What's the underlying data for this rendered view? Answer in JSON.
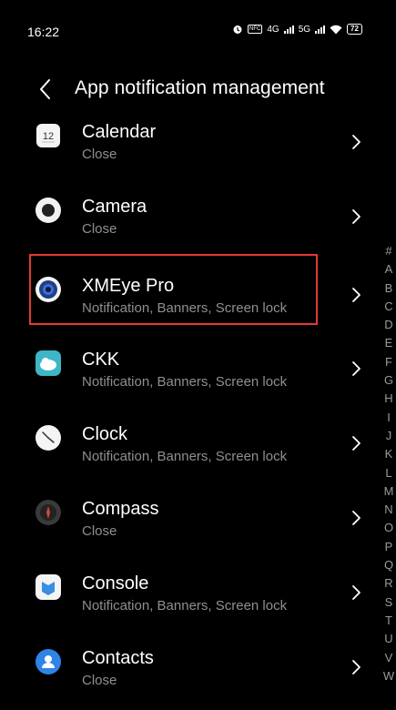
{
  "status_bar": {
    "time": "16:22",
    "nfc_label": "NFC",
    "network_1": "4G",
    "network_2": "5G",
    "battery": "72"
  },
  "header": {
    "back_icon": "chevron-left-icon",
    "title": "App notification management"
  },
  "apps": [
    {
      "name": "Calendar",
      "status": "Close",
      "icon": "calendar-icon",
      "icon_text": "12"
    },
    {
      "name": "Camera",
      "status": "Close",
      "icon": "camera-icon"
    },
    {
      "name": "XMEye Pro",
      "status": "Notification, Banners, Screen lock",
      "icon": "xmeye-icon",
      "highlighted": true,
      "highlight_color": "#e53935"
    },
    {
      "name": "CKK",
      "status": "Notification, Banners, Screen lock",
      "icon": "ckk-icon"
    },
    {
      "name": "Clock",
      "status": "Notification, Banners, Screen lock",
      "icon": "clock-icon"
    },
    {
      "name": "Compass",
      "status": "Close",
      "icon": "compass-icon"
    },
    {
      "name": "Console",
      "status": "Notification, Banners, Screen lock",
      "icon": "console-icon"
    },
    {
      "name": "Contacts",
      "status": "Close",
      "icon": "contacts-icon"
    }
  ],
  "index_letters": [
    "#",
    "A",
    "B",
    "C",
    "D",
    "E",
    "F",
    "G",
    "H",
    "I",
    "J",
    "K",
    "L",
    "M",
    "N",
    "O",
    "P",
    "Q",
    "R",
    "S",
    "T",
    "U",
    "V",
    "W"
  ],
  "colors": {
    "background": "#000000",
    "text_primary": "#ffffff",
    "text_secondary": "#8f8f8f",
    "highlight": "#e53935"
  }
}
